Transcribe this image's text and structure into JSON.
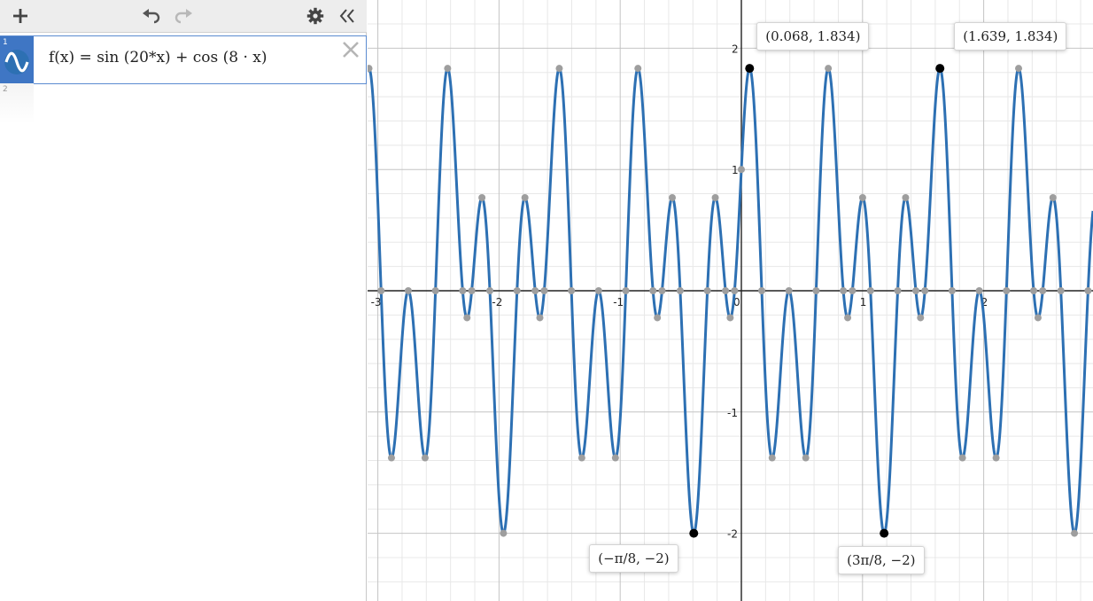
{
  "toolbar": {
    "add_icon": "plus-icon",
    "undo_icon": "undo-icon",
    "redo_icon": "redo-icon",
    "settings_icon": "gear-icon",
    "collapse_icon": "double-chevron-left-icon"
  },
  "expressions": [
    {
      "index": "1",
      "latex": "f(x) = sin (20*x) + cos (8 · x)",
      "color": "#2d70b3",
      "icon": "wave-icon"
    },
    {
      "index": "2",
      "latex": ""
    }
  ],
  "graph": {
    "x_ticks": [
      "-3",
      "-2",
      "-1",
      "0",
      "1",
      "2"
    ],
    "y_ticks": [
      "2",
      "1",
      "-1",
      "-2"
    ],
    "curve_color": "#2d70b3",
    "xlim": [
      -3.05,
      2.95
    ],
    "ylim": [
      -2.55,
      2.4
    ],
    "point_labels": [
      {
        "text": "(0.068, 1.834)",
        "x": 0.068,
        "y": 1.834
      },
      {
        "text": "(1.639, 1.834)",
        "x": 1.639,
        "y": 1.834
      },
      {
        "text": "(−π/8, −2)",
        "x": -0.3927,
        "y": -2
      },
      {
        "text": "(3π/8, −2)",
        "x": 1.1781,
        "y": -2
      }
    ]
  },
  "chart_data": {
    "type": "line",
    "function": "sin(20x) + cos(8x)",
    "series": [
      {
        "name": "f(x) = sin (20*x) + cos (8 · x)",
        "color": "#2d70b3"
      }
    ],
    "xlim": [
      -3.05,
      2.95
    ],
    "ylim": [
      -2.55,
      2.4
    ],
    "grid": true,
    "labeled_points": [
      {
        "x": 0.068,
        "y": 1.834
      },
      {
        "x": 1.639,
        "y": 1.834
      },
      {
        "x": -0.3927,
        "y": -2
      },
      {
        "x": 1.1781,
        "y": -2
      }
    ]
  }
}
